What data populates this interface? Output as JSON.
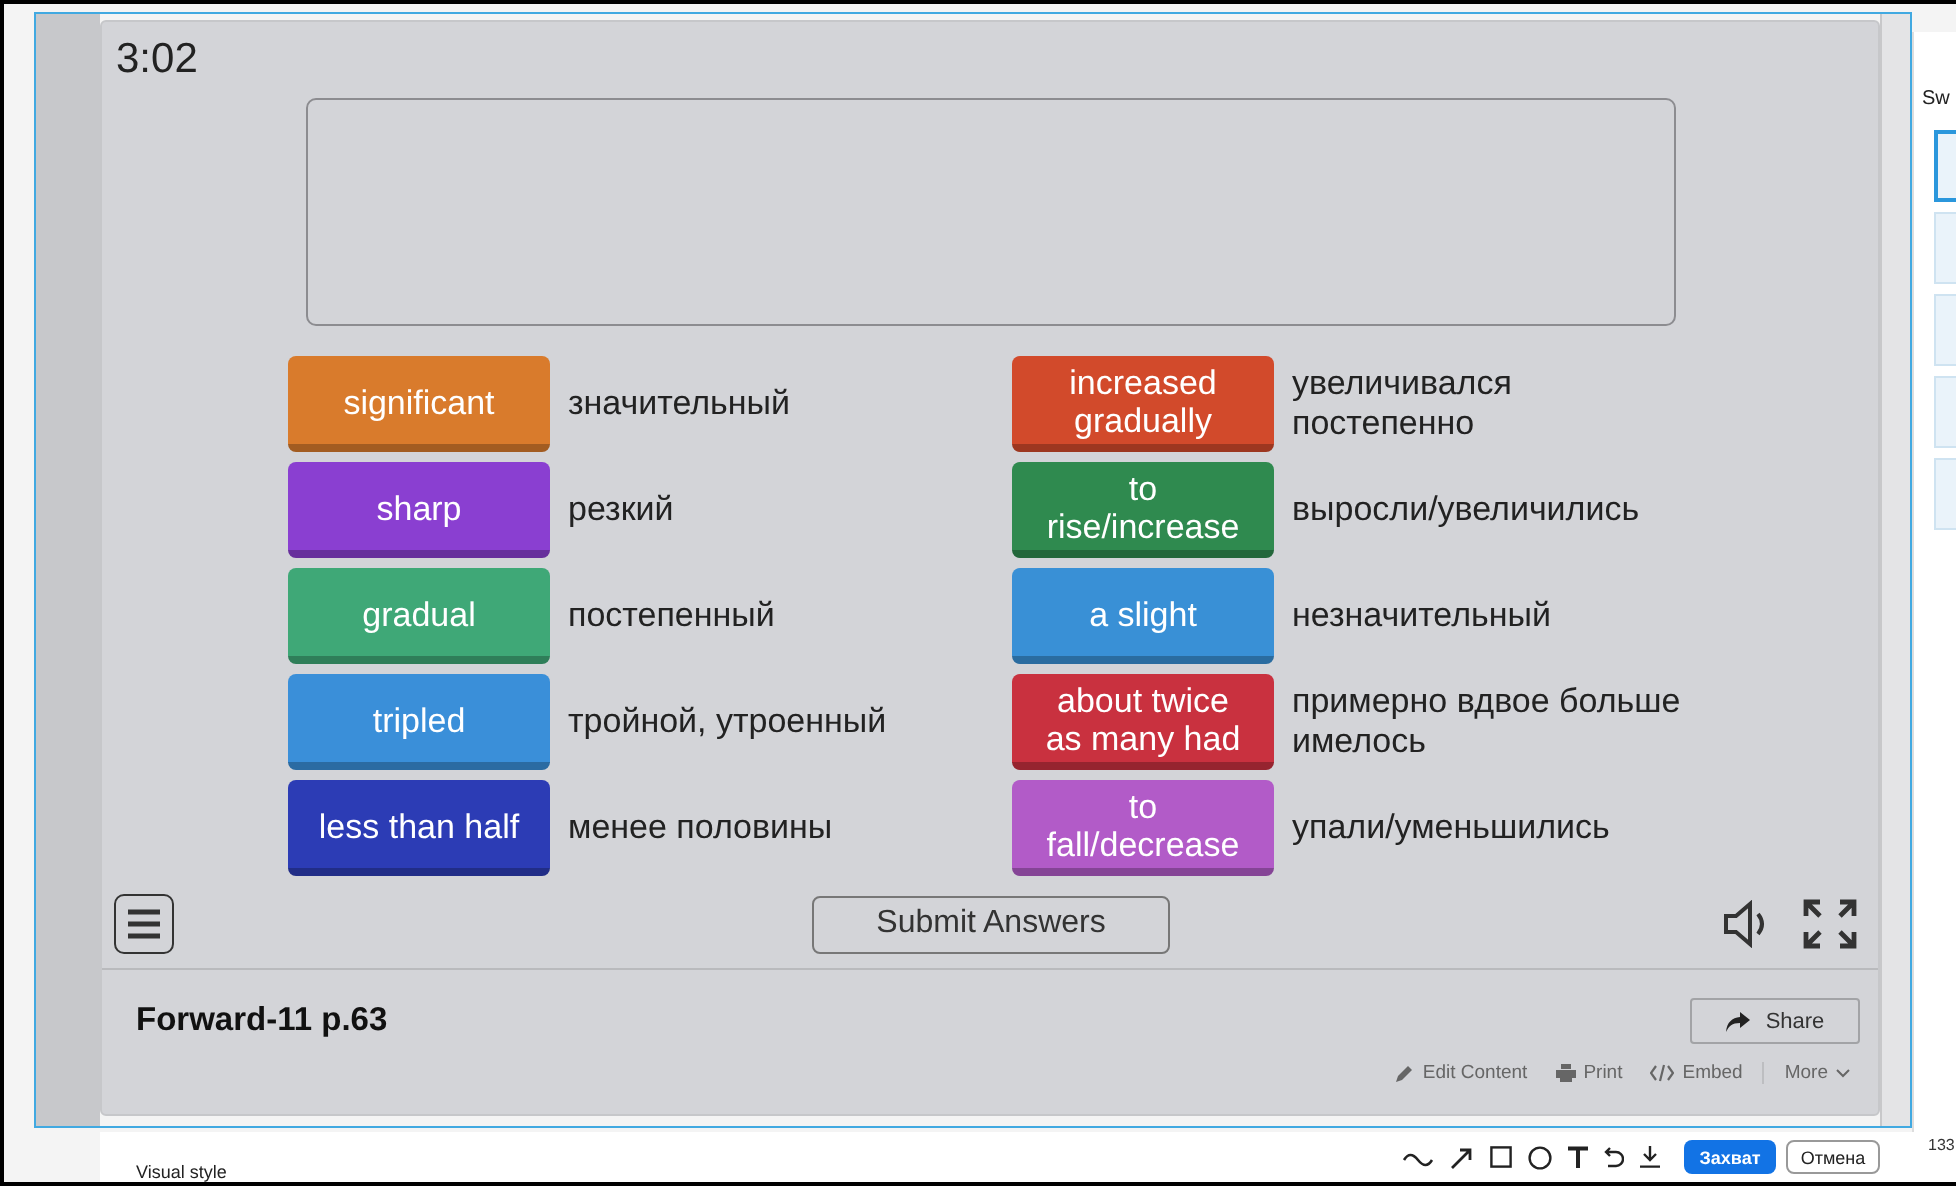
{
  "timer": "3:02",
  "columns": [
    {
      "pairs": [
        {
          "word": "significant",
          "translation": "значительный",
          "color": "#d97b2c"
        },
        {
          "word": "sharp",
          "translation": "резкий",
          "color": "#8a3fd1"
        },
        {
          "word": "gradual",
          "translation": "постепенный",
          "color": "#3fa877"
        },
        {
          "word": "tripled",
          "translation": "тройной, утроенный",
          "color": "#3a8fd9"
        },
        {
          "word": "less than half",
          "translation": "менее половины",
          "color": "#2c3cb5"
        }
      ]
    },
    {
      "pairs": [
        {
          "word": "increased gradually",
          "translation": "увеличивался постепенно",
          "color": "#d24a2b"
        },
        {
          "word": "to rise/increase",
          "translation": "выросли/увеличились",
          "color": "#2f8a4f"
        },
        {
          "word": "a slight",
          "translation": "незначительный",
          "color": "#3990d6"
        },
        {
          "word": "about twice as many had",
          "translation": "примерно вдвое больше имелось",
          "color": "#c9313f"
        },
        {
          "word": "to fall/decrease",
          "translation": "упали/уменьшились",
          "color": "#b25bc8"
        }
      ]
    }
  ],
  "submit": "Submit Answers",
  "footer": {
    "title": "Forward-11 p.63",
    "share": "Share",
    "links": [
      {
        "kind": "edit",
        "label": "Edit Content"
      },
      {
        "kind": "print",
        "label": "Print"
      },
      {
        "kind": "embed",
        "label": "Embed"
      },
      {
        "kind": "more",
        "label": "More"
      }
    ]
  },
  "side_panel": {
    "heading": "Sw",
    "thumbnails": [
      {
        "selected": true
      },
      {
        "selected": false
      },
      {
        "selected": false
      },
      {
        "selected": false
      },
      {
        "selected": false
      }
    ]
  },
  "bottom_bar": {
    "section": "Visual style",
    "capture": "Захват",
    "cancel": "Отмена",
    "zoom": "133"
  }
}
